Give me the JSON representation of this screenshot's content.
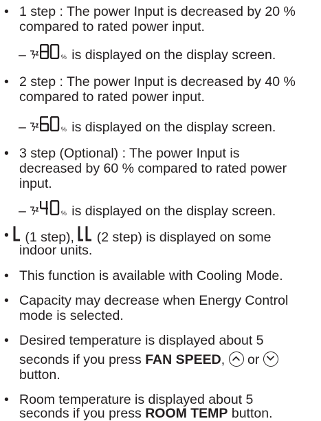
{
  "items": [
    {
      "bullet": "•",
      "lines": [
        "1 step : The power Input is decreased by 20 %",
        "compared to rated power input."
      ]
    },
    {
      "sub_prefix": "–",
      "sub_value": "80",
      "sub_unit": "%",
      "sub_text": "is displayed on the display screen."
    },
    {
      "bullet": "•",
      "lines": [
        "2 step : The power Input is decreased by 40 %",
        "compared to rated power input."
      ]
    },
    {
      "sub_prefix": "–",
      "sub_value": "60",
      "sub_unit": "%",
      "sub_text": "is displayed on the display screen."
    },
    {
      "bullet": "•",
      "lines": [
        "3 step (Optional) : The power Input is",
        "decreased by 60 % compared to rated power",
        "input."
      ]
    },
    {
      "sub_prefix": "–",
      "sub_value": "40",
      "sub_unit": "%",
      "sub_text": "is displayed on the display screen."
    }
  ],
  "step_display": {
    "one": "(1 step),",
    "two": "(2 step) is displayed on some",
    "line2": "indoor units."
  },
  "notes": {
    "cooling": "This function is available with Cooling Mode.",
    "capacity_1": "Capacity may decrease when Energy Control",
    "capacity_2": "mode is selected.",
    "desired_1": "Desired temperature is displayed about 5",
    "desired_2a": "seconds if you press",
    "desired_bold": "FAN SPEED",
    "desired_2b": ",",
    "desired_or": "or",
    "desired_3": "button.",
    "room_1": "Room temperature is displayed about 5",
    "room_2a": "seconds if you press",
    "room_bold": "ROOM TEMP",
    "room_2b": "button."
  },
  "bullet": "•"
}
